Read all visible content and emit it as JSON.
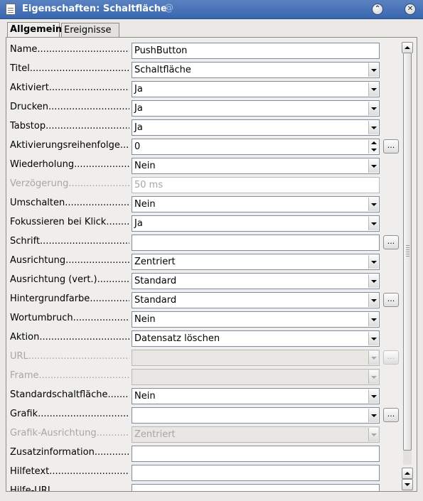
{
  "window": {
    "title": "Eigenschaften: Schaltfläche",
    "minimize_glyph": "⌃",
    "close_glyph": "✕"
  },
  "tabs": [
    {
      "label": "Allgemein",
      "active": true
    },
    {
      "label": "Ereignisse",
      "active": false
    }
  ],
  "more_button_label": "...",
  "properties": [
    {
      "label": "Name",
      "control": "text",
      "value": "PushButton"
    },
    {
      "label": "Titel",
      "control": "dropdown",
      "value": "Schaltfläche"
    },
    {
      "label": "Aktiviert",
      "control": "dropdown",
      "value": "Ja"
    },
    {
      "label": "Drucken",
      "control": "dropdown",
      "value": "Ja"
    },
    {
      "label": "Tabstop",
      "control": "dropdown",
      "value": "Ja"
    },
    {
      "label": "Aktivierungsreihenfolge",
      "control": "spin",
      "value": "0",
      "more": true
    },
    {
      "label": "Wiederholung",
      "control": "dropdown",
      "value": "Nein"
    },
    {
      "label": "Verzögerung",
      "control": "text",
      "value": "50 ms",
      "disabled": true
    },
    {
      "label": "Umschalten",
      "control": "dropdown",
      "value": "Nein"
    },
    {
      "label": "Fokussieren bei Klick",
      "control": "dropdown",
      "value": "Ja"
    },
    {
      "label": "Schrift",
      "control": "text",
      "value": "",
      "more": true
    },
    {
      "label": "Ausrichtung",
      "control": "dropdown",
      "value": "Zentriert"
    },
    {
      "label": "Ausrichtung (vert.)",
      "control": "dropdown",
      "value": "Standard"
    },
    {
      "label": "Hintergrundfarbe",
      "control": "dropdown",
      "value": "Standard",
      "more": true
    },
    {
      "label": "Wortumbruch",
      "control": "dropdown",
      "value": "Nein"
    },
    {
      "label": "Aktion",
      "control": "dropdown",
      "value": "Datensatz löschen"
    },
    {
      "label": "URL",
      "control": "dropdown",
      "value": "",
      "disabled": true,
      "more": true
    },
    {
      "label": "Frame",
      "control": "dropdown",
      "value": "",
      "disabled": true
    },
    {
      "label": "Standardschaltfläche",
      "control": "dropdown",
      "value": "Nein"
    },
    {
      "label": "Grafik",
      "control": "dropdown",
      "value": "",
      "more": true
    },
    {
      "label": "Grafik-Ausrichtung",
      "control": "dropdown",
      "value": "Zentriert",
      "disabled": true
    },
    {
      "label": "Zusatzinformation",
      "control": "text",
      "value": ""
    },
    {
      "label": "Hilfetext",
      "control": "text",
      "value": ""
    },
    {
      "label": "Hilfe-URL",
      "control": "text",
      "value": ""
    }
  ]
}
